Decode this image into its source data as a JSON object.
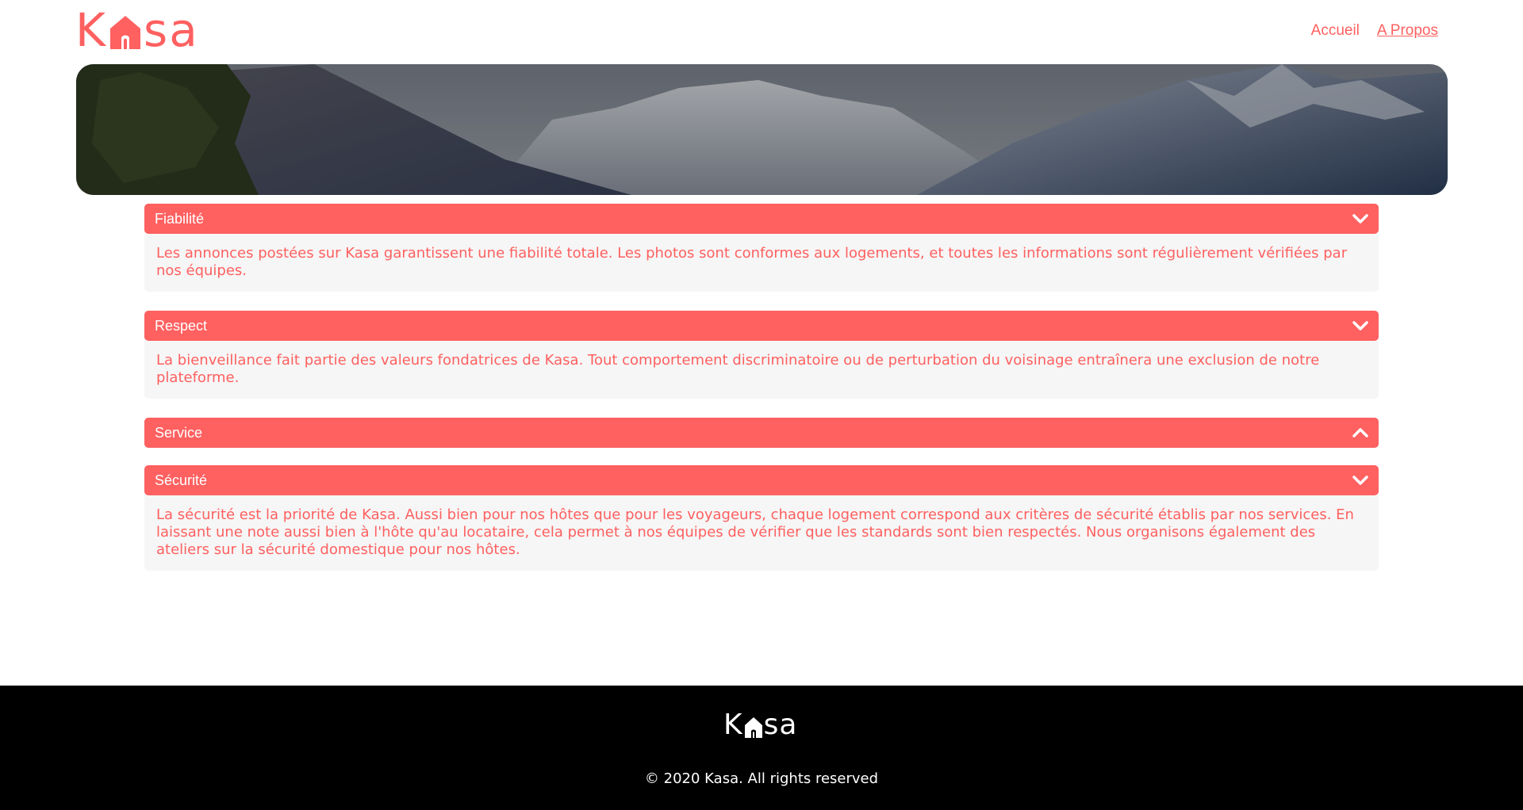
{
  "header": {
    "logo_text_left": "K",
    "logo_text_right": "sa",
    "nav": [
      {
        "label": "Accueil",
        "active": false
      },
      {
        "label": "A Propos",
        "active": true
      }
    ]
  },
  "collapses": [
    {
      "title": "Fiabilité",
      "open": true,
      "body": "Les annonces postées sur Kasa garantissent une fiabilité totale. Les photos sont conformes aux logements, et toutes les informations sont régulièrement vérifiées par nos équipes."
    },
    {
      "title": "Respect",
      "open": true,
      "body": "La bienveillance fait partie des valeurs fondatrices de Kasa. Tout comportement discriminatoire ou de perturbation du voisinage entraînera une exclusion de notre plateforme."
    },
    {
      "title": "Service",
      "open": false,
      "body": ""
    },
    {
      "title": "Sécurité",
      "open": true,
      "body": "La sécurité est la priorité de Kasa. Aussi bien pour nos hôtes que pour les voyageurs, chaque logement correspond aux critères de sécurité établis par nos services. En laissant une note aussi bien à l'hôte qu'au locataire, cela permet à nos équipes de vérifier que les standards sont bien respectés. Nous organisons également des ateliers sur la sécurité domestique pour nos hôtes."
    }
  ],
  "footer": {
    "logo_text_left": "K",
    "logo_text_right": "sa",
    "copyright": "© 2020 Kasa. All rights reserved"
  },
  "colors": {
    "primary": "#FF6060",
    "collapse_bg": "#F6F6F6",
    "footer_bg": "#000000"
  },
  "icons": {
    "open": "chevron-down-icon",
    "closed": "chevron-up-icon"
  }
}
